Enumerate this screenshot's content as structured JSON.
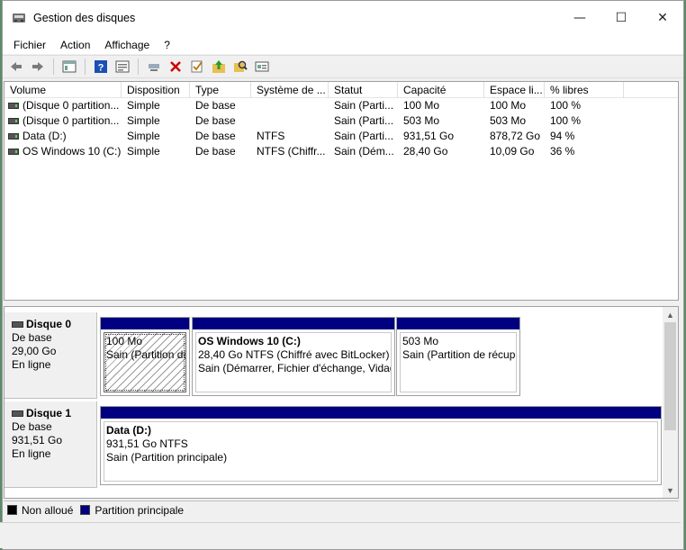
{
  "window": {
    "title": "Gestion des disques",
    "controls": {
      "minimize": "—",
      "maximize": "☐",
      "close": "✕"
    }
  },
  "menu": [
    "Fichier",
    "Action",
    "Affichage",
    "?"
  ],
  "toolbar": {
    "icons": [
      "back-icon",
      "forward-icon",
      "console-tree-icon",
      "help-icon",
      "properties-icon",
      "connect-icon",
      "delete-icon",
      "check-icon",
      "folder-up-icon",
      "find-icon",
      "options-icon"
    ],
    "colors": {
      "delete": "#cc0000",
      "help": "#1a4fb5"
    }
  },
  "list": {
    "columns": [
      "Volume",
      "Disposition",
      "Type",
      "Système de ...",
      "Statut",
      "Capacité",
      "Espace li...",
      "% libres"
    ],
    "rows": [
      [
        "(Disque 0 partition...",
        "Simple",
        "De base",
        "",
        "Sain (Parti...",
        "100 Mo",
        "100 Mo",
        "100 %"
      ],
      [
        "(Disque 0 partition...",
        "Simple",
        "De base",
        "",
        "Sain (Parti...",
        "503 Mo",
        "503 Mo",
        "100 %"
      ],
      [
        "Data (D:)",
        "Simple",
        "De base",
        "NTFS",
        "Sain (Parti...",
        "931,51 Go",
        "878,72 Go",
        "94 %"
      ],
      [
        "OS Windows 10 (C:)",
        "Simple",
        "De base",
        "NTFS (Chiffr...",
        "Sain (Dém...",
        "28,40 Go",
        "10,09 Go",
        "36 %"
      ]
    ]
  },
  "disks": [
    {
      "name": "Disque 0",
      "type": "De base",
      "size": "29,00 Go",
      "state": "En ligne",
      "partitions": [
        {
          "title": "",
          "line1": "100 Mo",
          "line2": "Sain (Partition de"
        },
        {
          "title": "OS Windows 10  (C:)",
          "line1": "28,40 Go NTFS (Chiffré avec BitLocker)",
          "line2": "Sain (Démarrer, Fichier d'échange, Vidag"
        },
        {
          "title": "",
          "line1": "503 Mo",
          "line2": "Sain (Partition de récup"
        }
      ]
    },
    {
      "name": "Disque 1",
      "type": "De base",
      "size": "931,51 Go",
      "state": "En ligne",
      "partitions": [
        {
          "title": "Data  (D:)",
          "line1": "931,51 Go NTFS",
          "line2": "Sain (Partition principale)"
        }
      ]
    }
  ],
  "legend": {
    "items": [
      {
        "label": "Non alloué",
        "color": "#000000"
      },
      {
        "label": "Partition principale",
        "color": "#000080"
      }
    ]
  }
}
